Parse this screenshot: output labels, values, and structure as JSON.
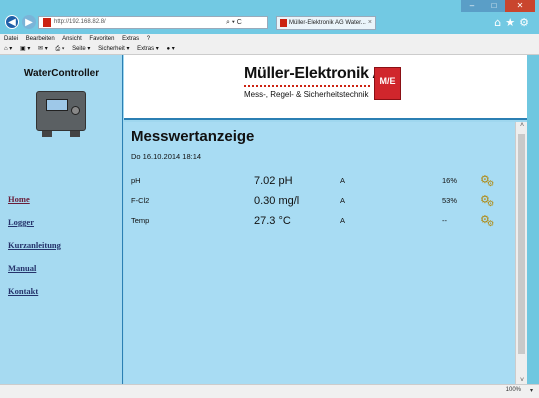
{
  "browser": {
    "address": "http://192.168.82.8/",
    "tab_title": "Müller-Elektronik AG Water...",
    "tab_close": "×",
    "address_controls": "⌕ ▾ C",
    "menu": [
      "Datei",
      "Bearbeiten",
      "Ansicht",
      "Favoriten",
      "Extras",
      "?"
    ],
    "commands": [
      "⌂ ▾",
      "▣ ▾",
      "✉ ▾",
      "⎙ ▾",
      "Seite ▾",
      "Sicherheit ▾",
      "Extras ▾",
      "● ▾"
    ],
    "zoom": "100%",
    "icons": {
      "back": "back-arrow-icon",
      "forward": "forward-arrow-icon",
      "home": "home-icon",
      "favorites": "star-icon",
      "settings": "gear-icon"
    }
  },
  "sidebar": {
    "brand": "WaterController",
    "nav": [
      {
        "label": "Home",
        "active": true
      },
      {
        "label": "Logger",
        "active": false
      },
      {
        "label": "Kurzanleitung",
        "active": false
      },
      {
        "label": "Manual",
        "active": false
      },
      {
        "label": "Kontakt",
        "active": false
      }
    ]
  },
  "header": {
    "company": "Müller-Elektronik AG",
    "tagline": "Mess-, Regel- & Sicherheitstechnik",
    "logo_mark": "M/E"
  },
  "main": {
    "title": "Messwertanzeige",
    "timestamp": "Do 16.10.2014 18:14",
    "rows": [
      {
        "name": "pH",
        "value": "7.02 pH",
        "mode": "A",
        "pct": "16%"
      },
      {
        "name": "F-Cl2",
        "value": "0.30 mg/l",
        "mode": "A",
        "pct": "53%"
      },
      {
        "name": "Temp",
        "value": "27.3 °C",
        "mode": "A",
        "pct": "--"
      }
    ]
  },
  "colors": {
    "accent": "#2b7fb3",
    "content_bg": "#a8dcf3",
    "brand_red": "#d0262c"
  }
}
